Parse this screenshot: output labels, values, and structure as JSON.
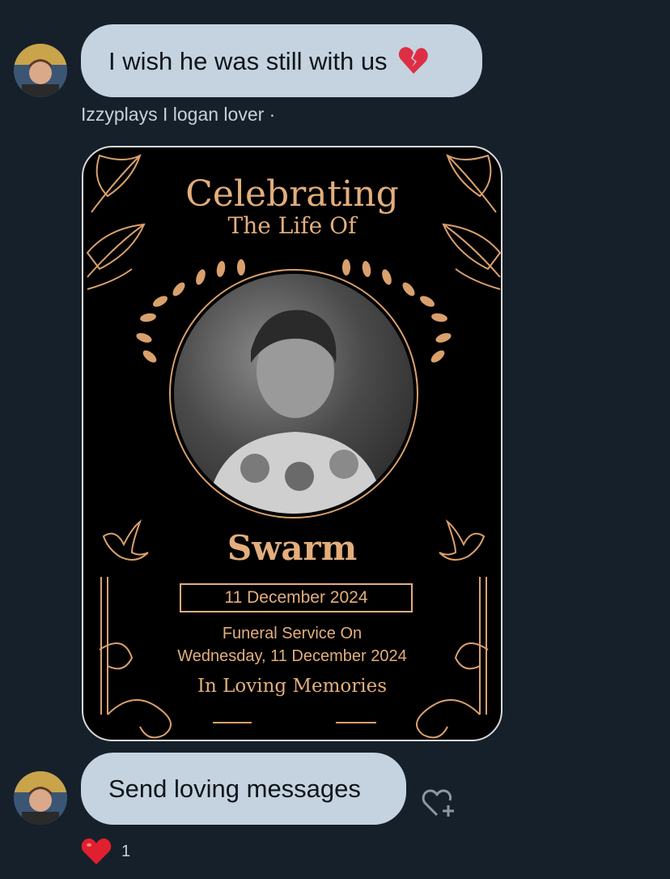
{
  "messages": [
    {
      "text": "I wish he was still with us",
      "emoji": "broken-heart-icon",
      "sender": "Izzyplays I logan lover ·"
    },
    {
      "text": "Send loving messages"
    }
  ],
  "memorial_card": {
    "title": "Celebrating",
    "subtitle": "The Life Of",
    "name": "Swarm",
    "date": "11 December 2024",
    "service_line1": "Funeral Service On",
    "service_line2": "Wednesday, 11 December 2024",
    "closing": "In Loving Memories"
  },
  "reactions": {
    "emoji": "red-heart-icon",
    "count": "1"
  },
  "colors": {
    "background": "#16202a",
    "bubble": "#c4d3df",
    "gold": "#e3ae7c",
    "heart": "#e0245e"
  }
}
